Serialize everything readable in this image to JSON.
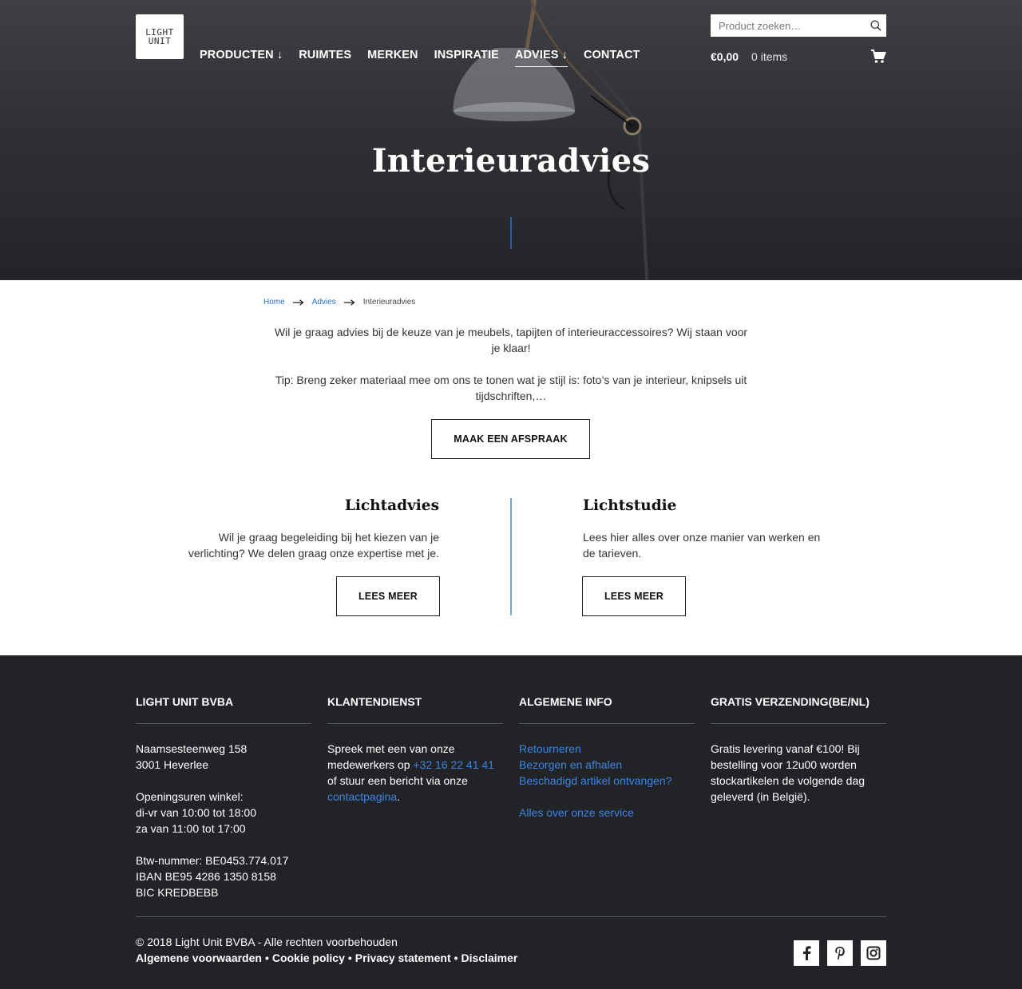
{
  "header": {
    "logo_line1": "LIGHT",
    "logo_line2": "UNIT",
    "nav": [
      {
        "label": "PRODUCTEN ↓"
      },
      {
        "label": "RUIMTES"
      },
      {
        "label": "MERKEN"
      },
      {
        "label": "INSPIRATIE"
      },
      {
        "label": "ADVIES ↓",
        "active": true
      },
      {
        "label": "CONTACT"
      }
    ],
    "search_placeholder": "Product zoeken…",
    "search_icon": "search-icon",
    "cart_amount": "€0,00",
    "cart_items": "0 items",
    "cart_icon": "shopping-cart-icon"
  },
  "hero": {
    "title": "Interieuradvies",
    "accent_color": "#2f5fa8"
  },
  "breadcrumb": {
    "home": "Home",
    "advies": "Advies",
    "current": "Interieuradvies"
  },
  "intro": {
    "paragraph1": "Wil je graag advies bij de keuze van je meubels, tapijten of interieuraccessoires? Wij staan voor je klaar!",
    "paragraph2": "Tip: Breng zeker materiaal mee om ons te tonen wat je stijl is: foto’s van je interieur, knipsels uit tijdschriften,…",
    "button": "MAAK EEN AFSPRAAK"
  },
  "columns": {
    "left": {
      "title": "Lichtadvies",
      "text": "Wil je graag begeleiding bij het kiezen van je verlichting? We delen graag onze expertise met je.",
      "button": "LEES MEER"
    },
    "right": {
      "title": "Lichtstudie",
      "text": "Lees hier alles over onze manier van werken en de tarieven.",
      "button": "LEES MEER"
    }
  },
  "footer": {
    "col1": {
      "title": "LIGHT UNIT BVBA",
      "address1": "Naamsesteenweg 158",
      "address2": "3001 Heverlee",
      "hours_title": "Openingsuren winkel:",
      "hours1": "di-vr van 10:00 tot 18:00",
      "hours2": "za van 11:00 tot 17:00",
      "vat": "Btw-nummer: BE0453.774.017",
      "iban": "IBAN BE95 4286 1350 8158",
      "bic": "BIC KREDBEBB"
    },
    "col2": {
      "title": "KLANTENDIENST",
      "text1": "Spreek met een van onze medewerkers op ",
      "phone": "+32 16 22 41 41",
      "text2": " of stuur een bericht via onze ",
      "contact_link": "contactpagina",
      "text3": "."
    },
    "col3": {
      "title": "ALGEMENE INFO",
      "links": [
        "Retourneren",
        "Bezorgen en afhalen",
        "Beschadigd artikel ontvangen?"
      ],
      "service_link": "Alles over onze service"
    },
    "col4": {
      "title": "GRATIS VERZENDING(BE/NL)",
      "text": "Gratis levering vanaf €100! Bij bestelling voor 12u00 worden stockartikelen de volgende dag geleverd (in België)."
    },
    "copyright": "© 2018 Light Unit BVBA - Alle rechten voorbehouden",
    "legal": [
      "Algemene voorwaarden",
      "Cookie policy",
      "Privacy statement",
      "Disclaimer"
    ],
    "social": [
      "facebook-icon",
      "pinterest-icon",
      "instagram-icon"
    ],
    "link_color": "#3d84e0"
  }
}
